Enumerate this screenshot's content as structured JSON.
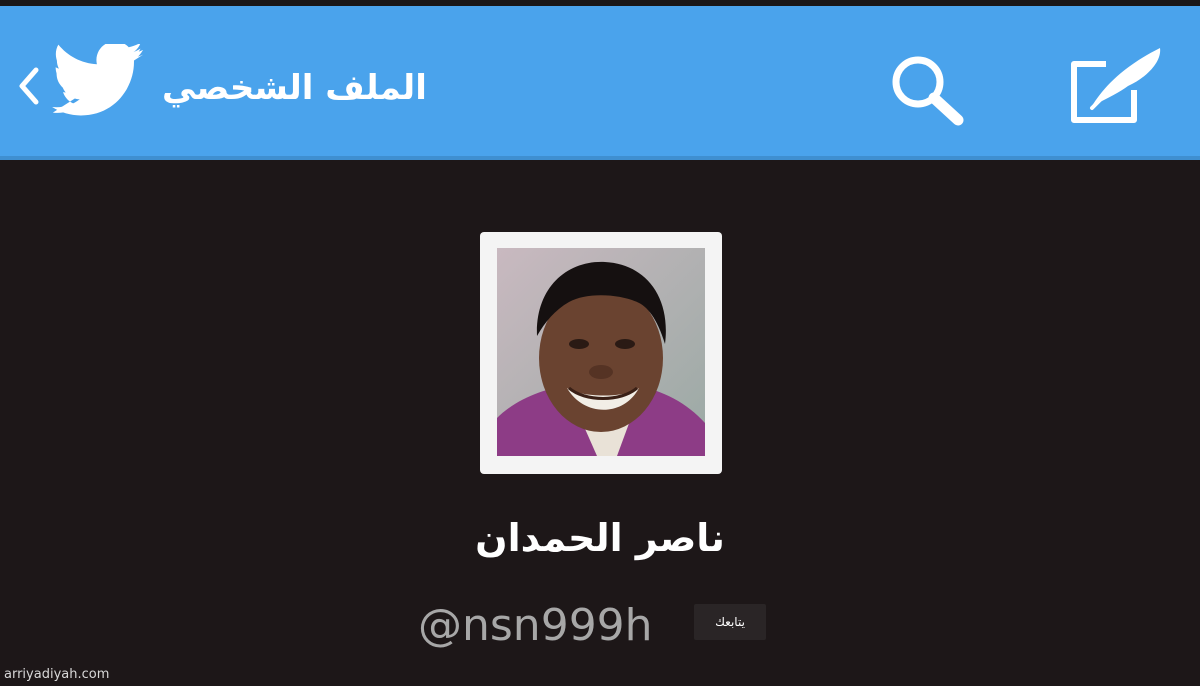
{
  "header": {
    "title": "الملف الشخصي",
    "back_icon": "chevron-left-icon",
    "logo_icon": "twitter-bird-icon",
    "search_icon": "search-icon",
    "compose_icon": "compose-icon",
    "bar_color": "#4aa3ec"
  },
  "profile": {
    "name": "ناصر الحمدان",
    "handle": "@nsn999h",
    "follows_you_badge": "يتابعك",
    "avatar": "profile-photo"
  },
  "watermark": "arriyadiyah.com",
  "colors": {
    "background": "#1d1718",
    "header": "#4aa3ec",
    "text": "#ffffff",
    "handle": "#a7a7a7"
  }
}
